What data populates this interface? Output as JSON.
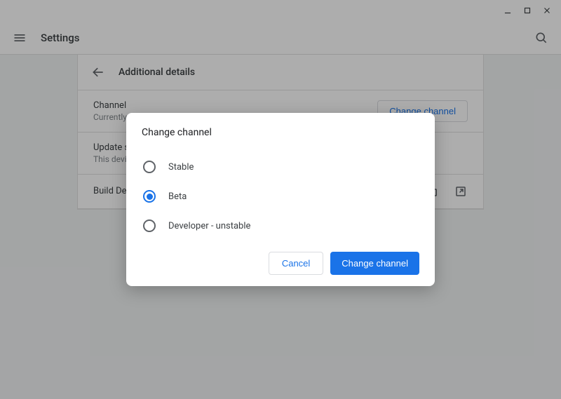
{
  "window": {
    "minimize_icon": "minimize",
    "maximize_icon": "maximize",
    "close_icon": "close"
  },
  "app_bar": {
    "title": "Settings"
  },
  "subheader": {
    "title": "Additional details"
  },
  "rows": {
    "channel": {
      "label": "Channel",
      "desc": "Currently on stable",
      "button": "Change channel"
    },
    "update": {
      "label": "Update schedule",
      "desc": "This device"
    },
    "build": {
      "label": "Build Details"
    }
  },
  "dialog": {
    "title": "Change channel",
    "options": [
      {
        "label": "Stable",
        "selected": false
      },
      {
        "label": "Beta",
        "selected": true
      },
      {
        "label": "Developer - unstable",
        "selected": false
      }
    ],
    "cancel": "Cancel",
    "confirm": "Change channel"
  }
}
